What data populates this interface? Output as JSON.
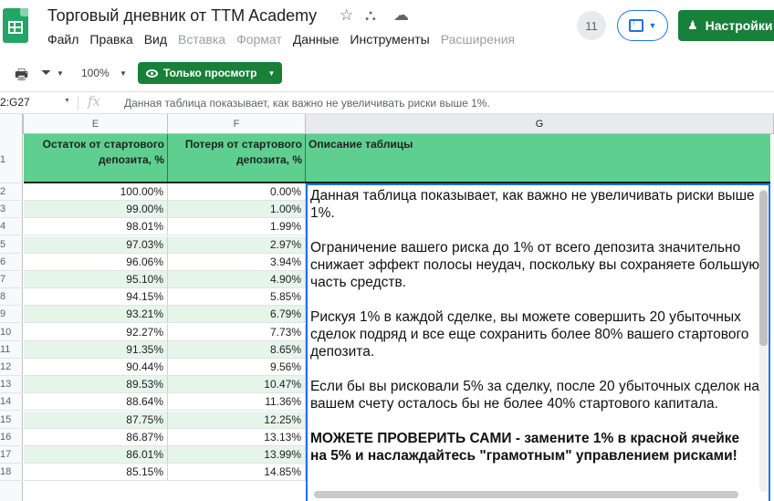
{
  "window": {
    "doc_title": "Торговый дневник от TTM Academy",
    "menu": [
      {
        "label": "Файл",
        "enabled": true
      },
      {
        "label": "Правка",
        "enabled": true
      },
      {
        "label": "Вид",
        "enabled": true
      },
      {
        "label": "Вставка",
        "enabled": false
      },
      {
        "label": "Формат",
        "enabled": false
      },
      {
        "label": "Данные",
        "enabled": true
      },
      {
        "label": "Инструменты",
        "enabled": true
      },
      {
        "label": "Расширения",
        "enabled": false
      }
    ],
    "collaborators_count": "11",
    "share_label": "Настройки"
  },
  "toolbar": {
    "zoom": "100%",
    "view_only_label": "Только просмотр"
  },
  "formula_bar": {
    "cell_ref": "2:G27",
    "fx": "fx",
    "content": "Данная таблица показывает, как важно не увеличивать риски выше 1%."
  },
  "columns": [
    "E",
    "F",
    "G"
  ],
  "header": {
    "e": "Остаток от стартового депозита, %",
    "f": "Потеря от стартового депозита, %",
    "g": "Описание таблицы"
  },
  "rows": [
    {
      "n": "2",
      "e": "100.00%",
      "f": "0.00%"
    },
    {
      "n": "3",
      "e": "99.00%",
      "f": "1.00%"
    },
    {
      "n": "4",
      "e": "98.01%",
      "f": "1.99%"
    },
    {
      "n": "5",
      "e": "97.03%",
      "f": "2.97%"
    },
    {
      "n": "6",
      "e": "96.06%",
      "f": "3.94%"
    },
    {
      "n": "7",
      "e": "95.10%",
      "f": "4.90%"
    },
    {
      "n": "8",
      "e": "94.15%",
      "f": "5.85%"
    },
    {
      "n": "9",
      "e": "93.21%",
      "f": "6.79%"
    },
    {
      "n": "10",
      "e": "92.27%",
      "f": "7.73%"
    },
    {
      "n": "11",
      "e": "91.35%",
      "f": "8.65%"
    },
    {
      "n": "12",
      "e": "90.44%",
      "f": "9.56%"
    },
    {
      "n": "13",
      "e": "89.53%",
      "f": "10.47%"
    },
    {
      "n": "14",
      "e": "88.64%",
      "f": "11.36%"
    },
    {
      "n": "15",
      "e": "87.75%",
      "f": "12.25%"
    },
    {
      "n": "16",
      "e": "86.87%",
      "f": "13.13%"
    },
    {
      "n": "17",
      "e": "86.01%",
      "f": "13.99%"
    },
    {
      "n": "18",
      "e": "85.15%",
      "f": "14.85%"
    }
  ],
  "description": [
    {
      "text": "Данная таблица показывает, как важно не увеличивать риски выше 1%.",
      "bold": false
    },
    {
      "text": "Ограничение вашего риска до 1% от всего депозита значительно снижает эффект полосы неудач, поскольку вы сохраняете большую часть средств.",
      "bold": false
    },
    {
      "text": "Рискуя 1% в каждой сделке, вы можете совершить 20 убыточных сделок подряд и все еще сохранить более 80% вашего стартового депозита.",
      "bold": false
    },
    {
      "text": "Если бы вы рисковали 5% за сделку, после 20 убыточных сделок на вашем счету осталось бы не более 40% стартового капитала.",
      "bold": false
    },
    {
      "text": "МОЖЕТЕ ПРОВЕРИТЬ САМИ - замените 1% в красной ячейке на 5% и наслаждайтесь \"грамотным\" управлением рисками!",
      "bold": true
    }
  ]
}
